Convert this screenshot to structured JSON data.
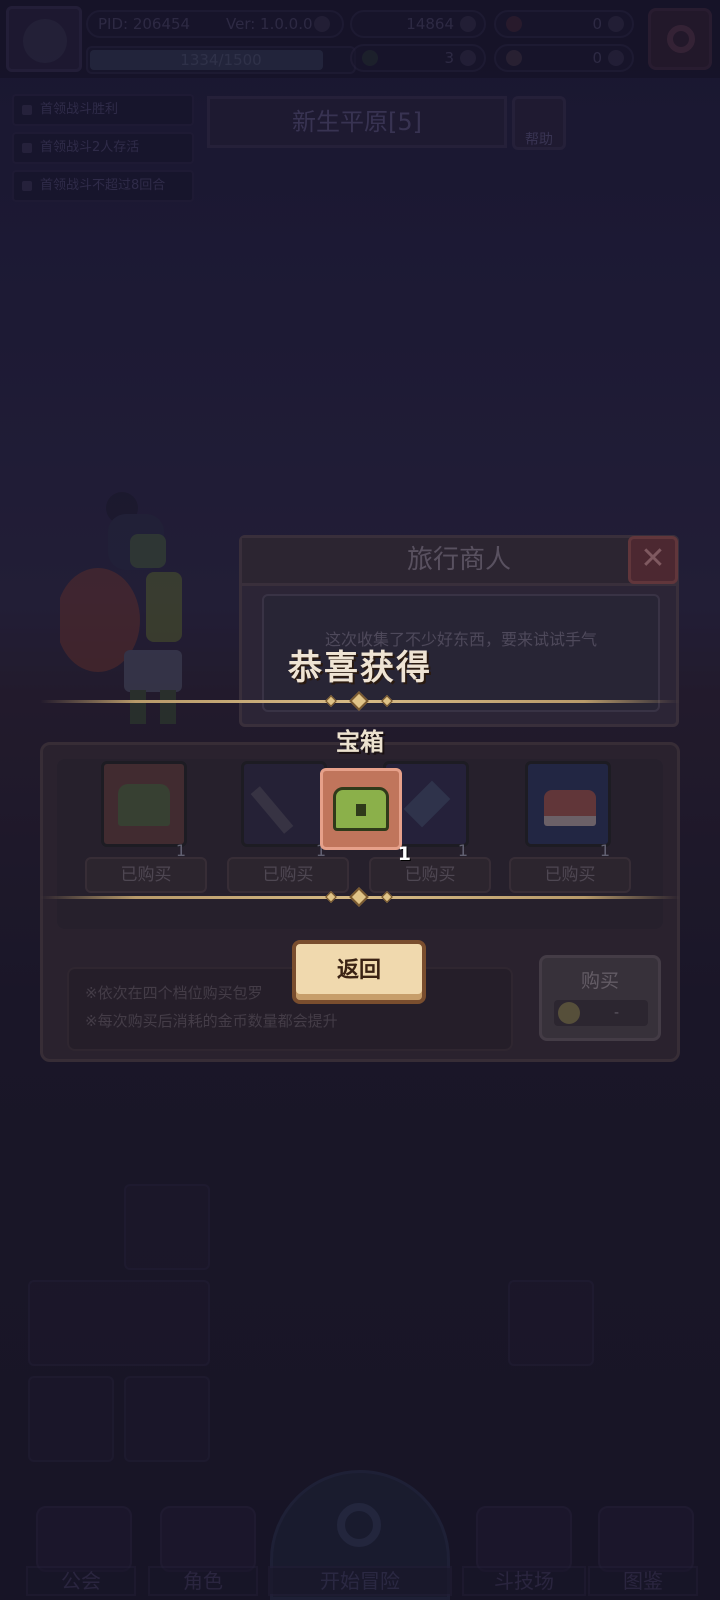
{
  "top_bar": {
    "pid": "PID: 206454",
    "version": "Ver: 1.0.0.0",
    "gold": "14864",
    "gems": "0",
    "clover": "3",
    "keys": "0",
    "xp_text": "1334/1500",
    "xp_progress": 0.889
  },
  "quests": [
    "首领战斗胜利",
    "首领战斗2人存活",
    "首领战斗不超过8回合"
  ],
  "stage": {
    "title": "新生平原[5]",
    "help_label": "帮助"
  },
  "merchant": {
    "title": "旅行商人",
    "dialog": "这次收集了不少好东西，要来试试手气"
  },
  "reward": {
    "congrats": "恭喜获得",
    "item_name": "宝箱",
    "quantity": "1",
    "back_label": "返回"
  },
  "shop": {
    "slots": [
      {
        "icon": "chest-icon",
        "qty": "1",
        "status": "已购买"
      },
      {
        "icon": "wand-icon",
        "qty": "1",
        "status": "已购买"
      },
      {
        "icon": "crystal-icon",
        "qty": "1",
        "status": "已购买"
      },
      {
        "icon": "treasure-box-icon",
        "qty": "1",
        "status": "已购买"
      }
    ],
    "info_lines": [
      "※依次在四个档位购买包罗",
      "※每次购买后消耗的金币数量都会提升"
    ],
    "buy_label": "购买",
    "buy_cost": "-"
  },
  "nav": {
    "items": [
      "公会",
      "角色",
      "开始冒险",
      "斗技场",
      "图鉴"
    ]
  },
  "colors": {
    "accent_gold": "#d7bb86",
    "reward_slot": "#c0755c",
    "back_button": "#f0d9ae"
  }
}
